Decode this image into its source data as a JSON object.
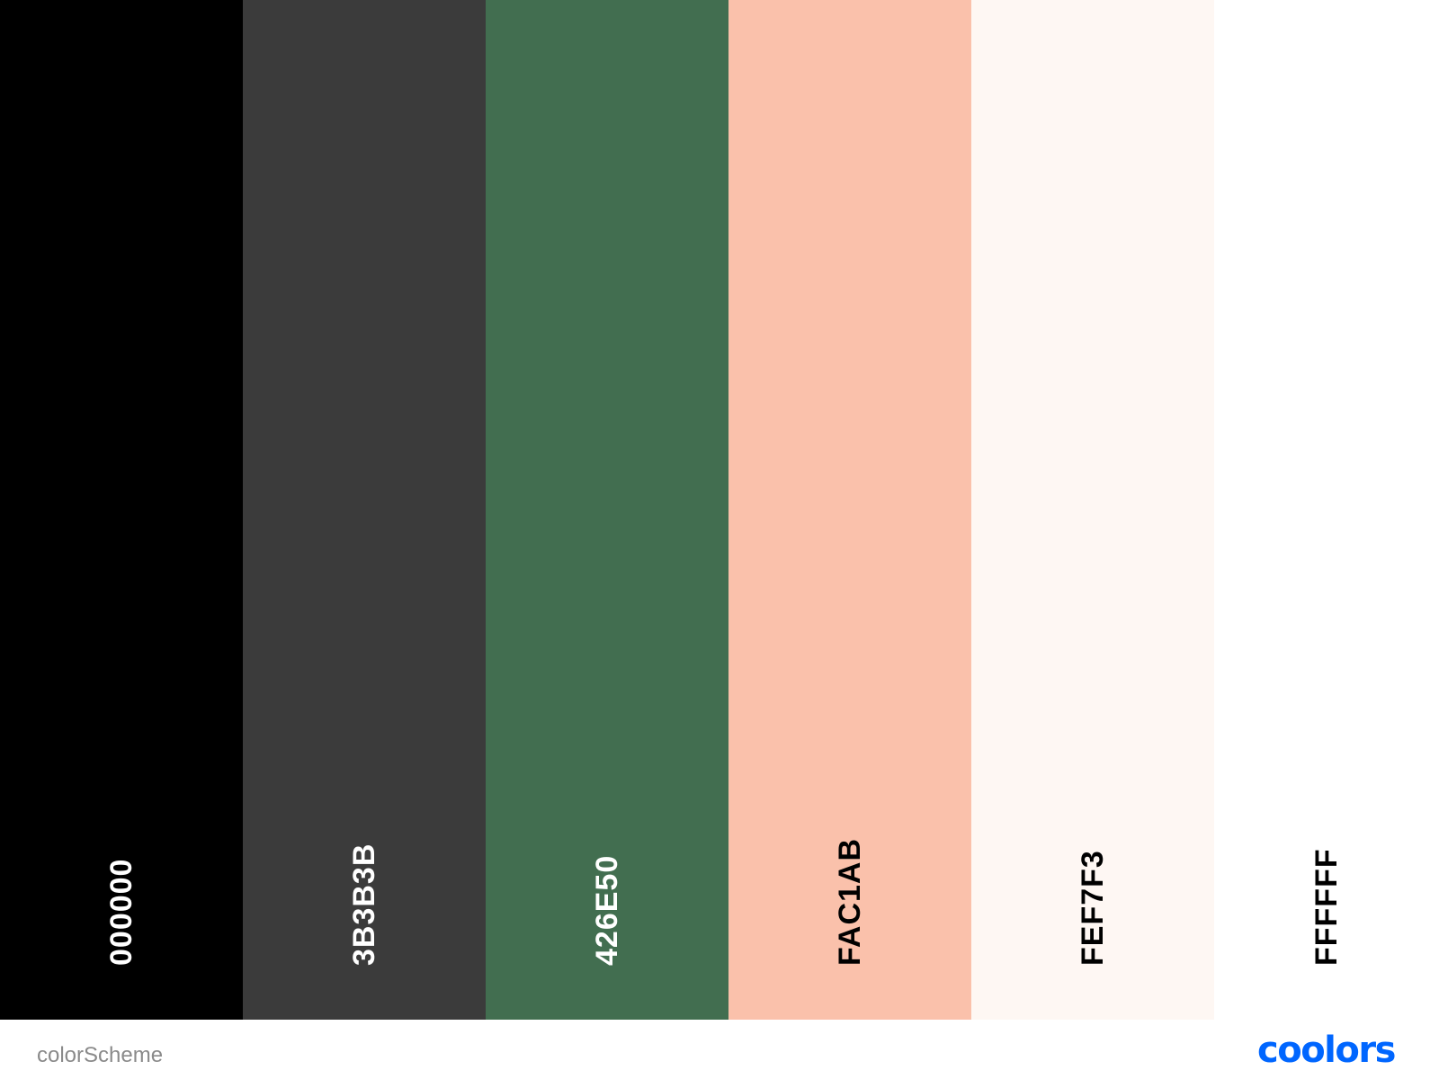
{
  "palette": {
    "colors": [
      {
        "hex": "000000",
        "color": "#000000",
        "text_color": "#ffffff"
      },
      {
        "hex": "3B3B3B",
        "color": "#3B3B3B",
        "text_color": "#ffffff"
      },
      {
        "hex": "426E50",
        "color": "#426E50",
        "text_color": "#ffffff"
      },
      {
        "hex": "FAC1AB",
        "color": "#FAC1AB",
        "text_color": "#000000"
      },
      {
        "hex": "FEF7F3",
        "color": "#FEF7F3",
        "text_color": "#000000"
      },
      {
        "hex": "FFFFFF",
        "color": "#FFFFFF",
        "text_color": "#000000"
      }
    ]
  },
  "footer": {
    "scheme_name": "colorScheme",
    "brand": "coolors",
    "brand_color": "#0066FF"
  }
}
